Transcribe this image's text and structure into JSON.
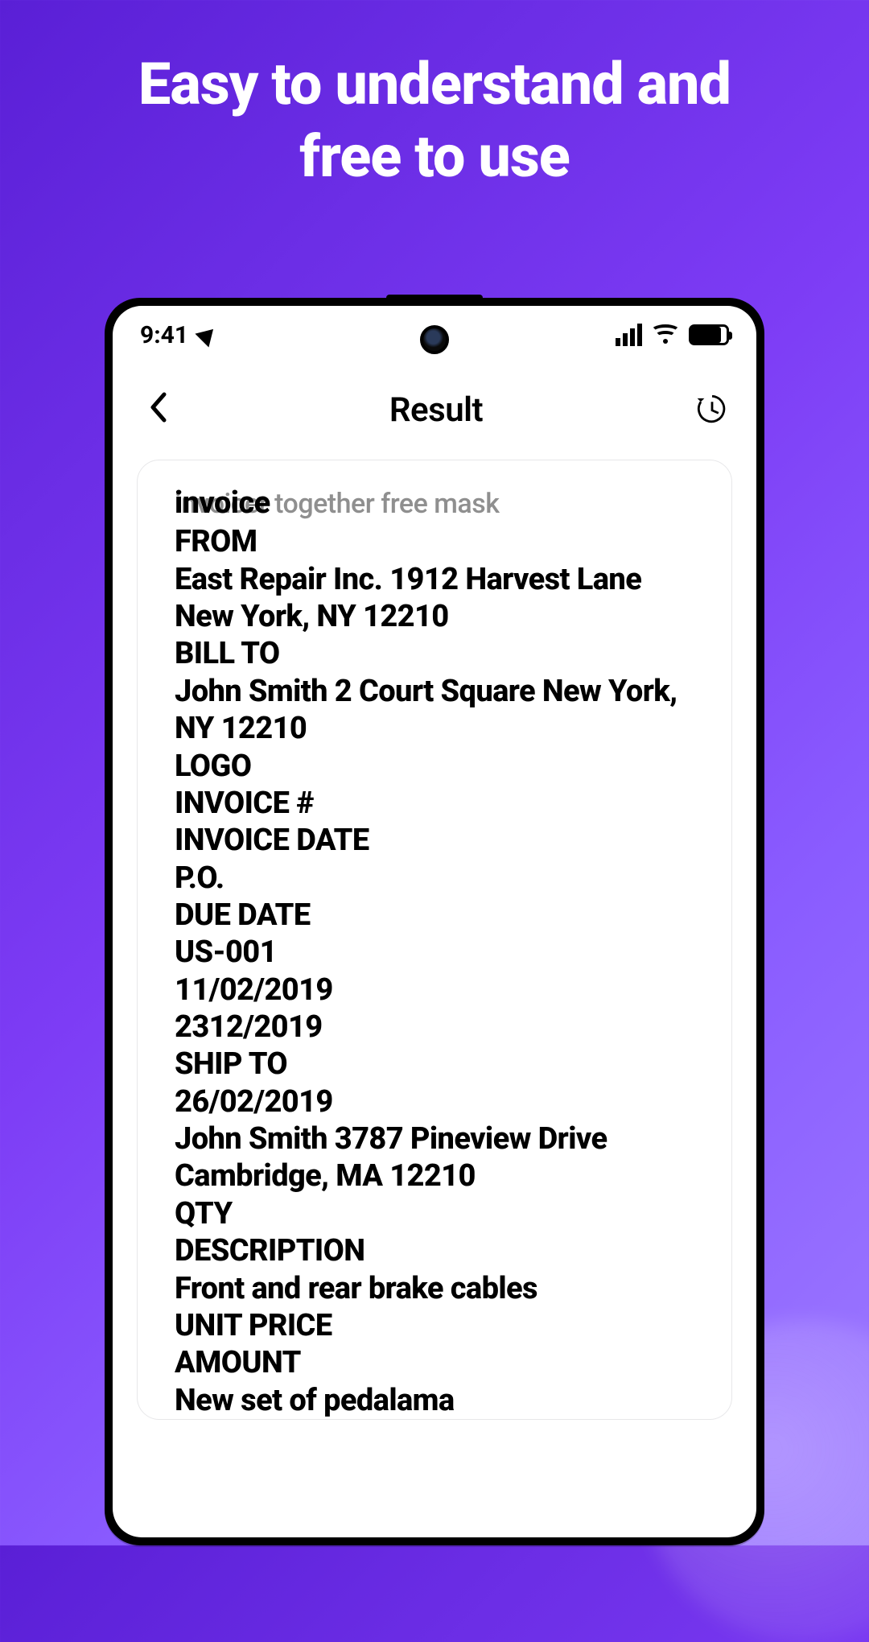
{
  "promo": {
    "headline_line1": "Easy to understand and",
    "headline_line2": "free to use"
  },
  "statusbar": {
    "time": "9:41"
  },
  "appbar": {
    "title": "Result"
  },
  "result": {
    "faded_overlay": "invoicer together free mask",
    "lines": [
      "invoice",
      "FROM",
      "East Repair Inc. 1912 Harvest Lane",
      "New York, NY 12210",
      "BILL TO",
      "John Smith 2 Court Square New York,",
      "NY 12210",
      "LOGO",
      "INVOICE #",
      "INVOICE DATE",
      "P.O.",
      "DUE DATE",
      "US-001",
      "11/02/2019",
      "2312/2019",
      "SHIP TO",
      "26/02/2019",
      "John Smith 3787 Pineview Drive",
      "Cambridge, MA 12210",
      "QTY",
      "DESCRIPTION",
      "Front and rear brake cables",
      "UNIT PRICE",
      "AMOUNT",
      "New set of pedalama"
    ]
  }
}
